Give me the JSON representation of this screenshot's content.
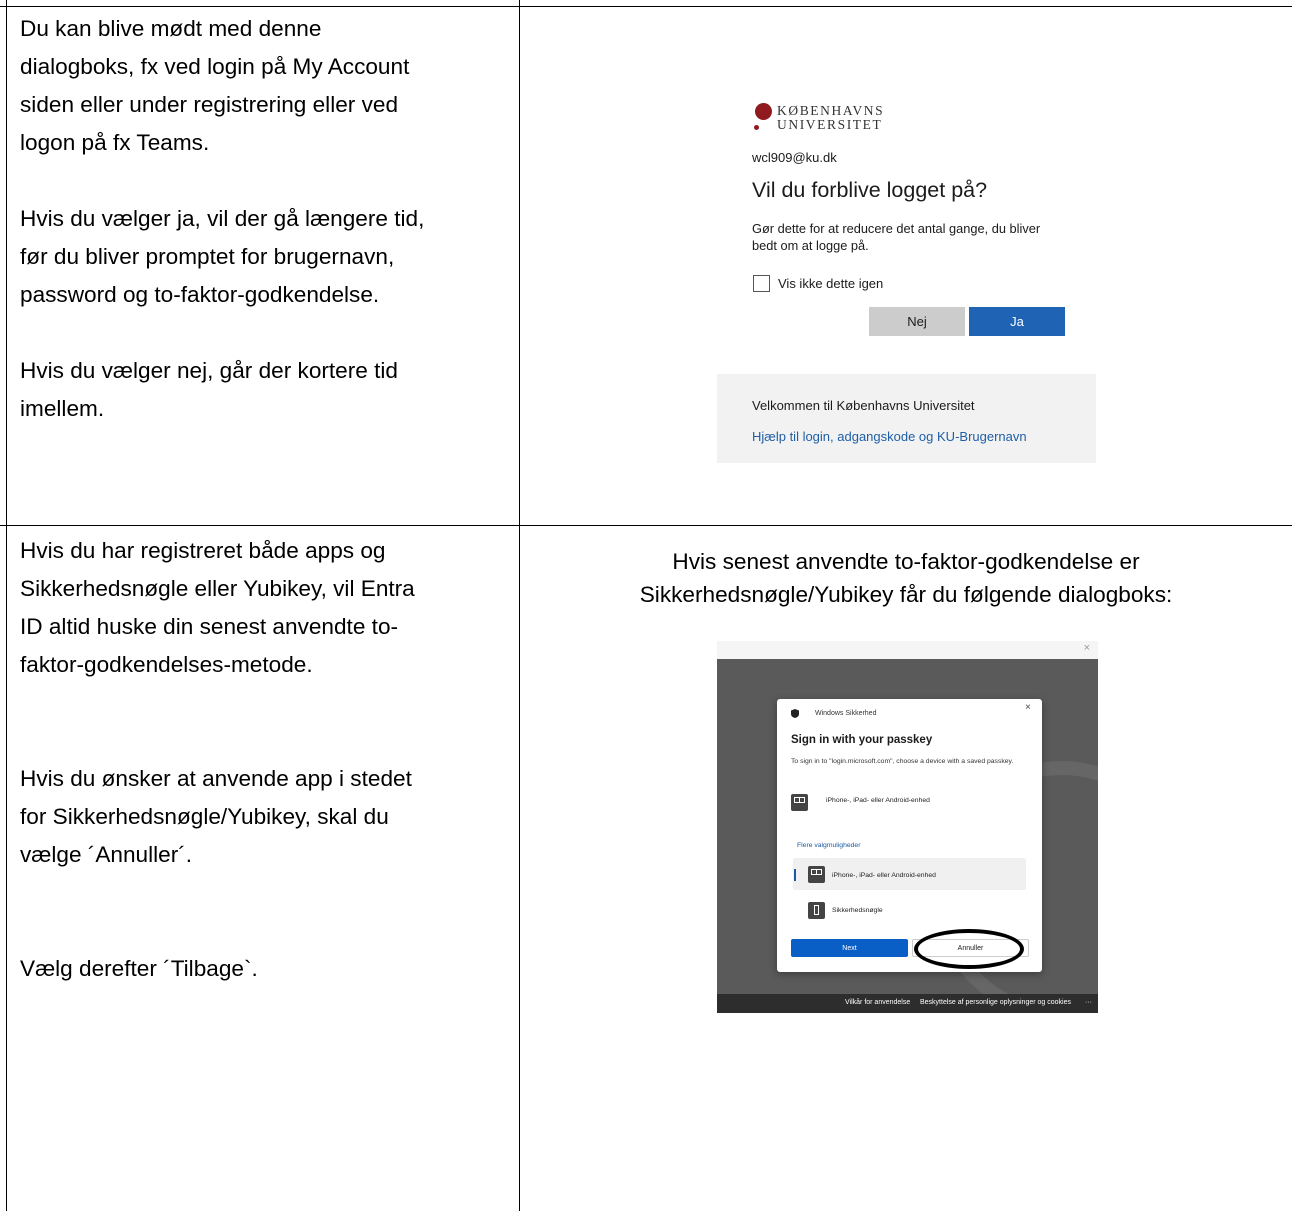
{
  "left_top": {
    "paragraphs": [
      [
        "Du kan blive mødt med denne",
        "dialogboks, fx ved login på My Account",
        "siden eller under registrering eller ved",
        "logon på fx Teams."
      ],
      [
        "Hvis du vælger ja, vil der gå længere tid,",
        "før du bliver promptet for brugernavn,",
        "password og to-faktor-godkendelse."
      ],
      [
        "Hvis du vælger nej, går der kortere tid",
        "imellem."
      ]
    ]
  },
  "ku_login": {
    "logo_line1": "KØBENHAVNS",
    "logo_line2": "UNIVERSITET",
    "email": "wcl909@ku.dk",
    "title": "Vil du forblive logget på?",
    "description": "Gør dette for at reducere det antal gange, du bliver bedt om at logge på.",
    "checkbox_label": "Vis ikke dette igen",
    "checkbox_checked": false,
    "no_label": "Nej",
    "yes_label": "Ja",
    "welcome": "Velkommen til Københavns Universitet",
    "help_link": "Hjælp til login, adgangskode og KU-Brugernavn",
    "brand_color": "#901a1e",
    "accent_color": "#1e63b4"
  },
  "left_bottom": {
    "p1": [
      "Hvis du har registreret både apps og",
      "Sikkerhedsnøgle eller Yubikey, vil Entra",
      "ID altid huske din senest anvendte to-",
      "faktor-godkendelses-metode."
    ],
    "p2": [
      "Hvis du ønsker at anvende app i stedet",
      "for Sikkerhedsnøgle/Yubikey, skal du",
      "vælge ´Annuller´."
    ],
    "p3": [
      "Vælg derefter ´Tilbage`."
    ]
  },
  "right_bottom": {
    "caption_line1": "Hvis senest anvendte to-faktor-godkendelse er",
    "caption_line2": "Sikkerhedsnøgle/Yubikey får du følgende dialogboks:"
  },
  "win_security": {
    "frame_close": "×",
    "app_name": "Windows Sikkerhed",
    "close": "×",
    "title": "Sign in with your passkey",
    "description": "To sign in to \"login.microsoft.com\", choose a device with a saved passkey.",
    "option_phone": "iPhone-, iPad- eller Android-enhed",
    "more_options": "Flere valgmuligheder",
    "option_phone_2": "iPhone-, iPad- eller Android-enhed",
    "option_key": "Sikkerhedsnøgle",
    "next_label": "Next",
    "cancel_label": "Annuller",
    "footer_terms": "Vilkår for anvendelse",
    "footer_privacy": "Beskyttelse af personlige oplysninger og cookies",
    "footer_more": "···",
    "accent_color": "#0a5fc6"
  }
}
